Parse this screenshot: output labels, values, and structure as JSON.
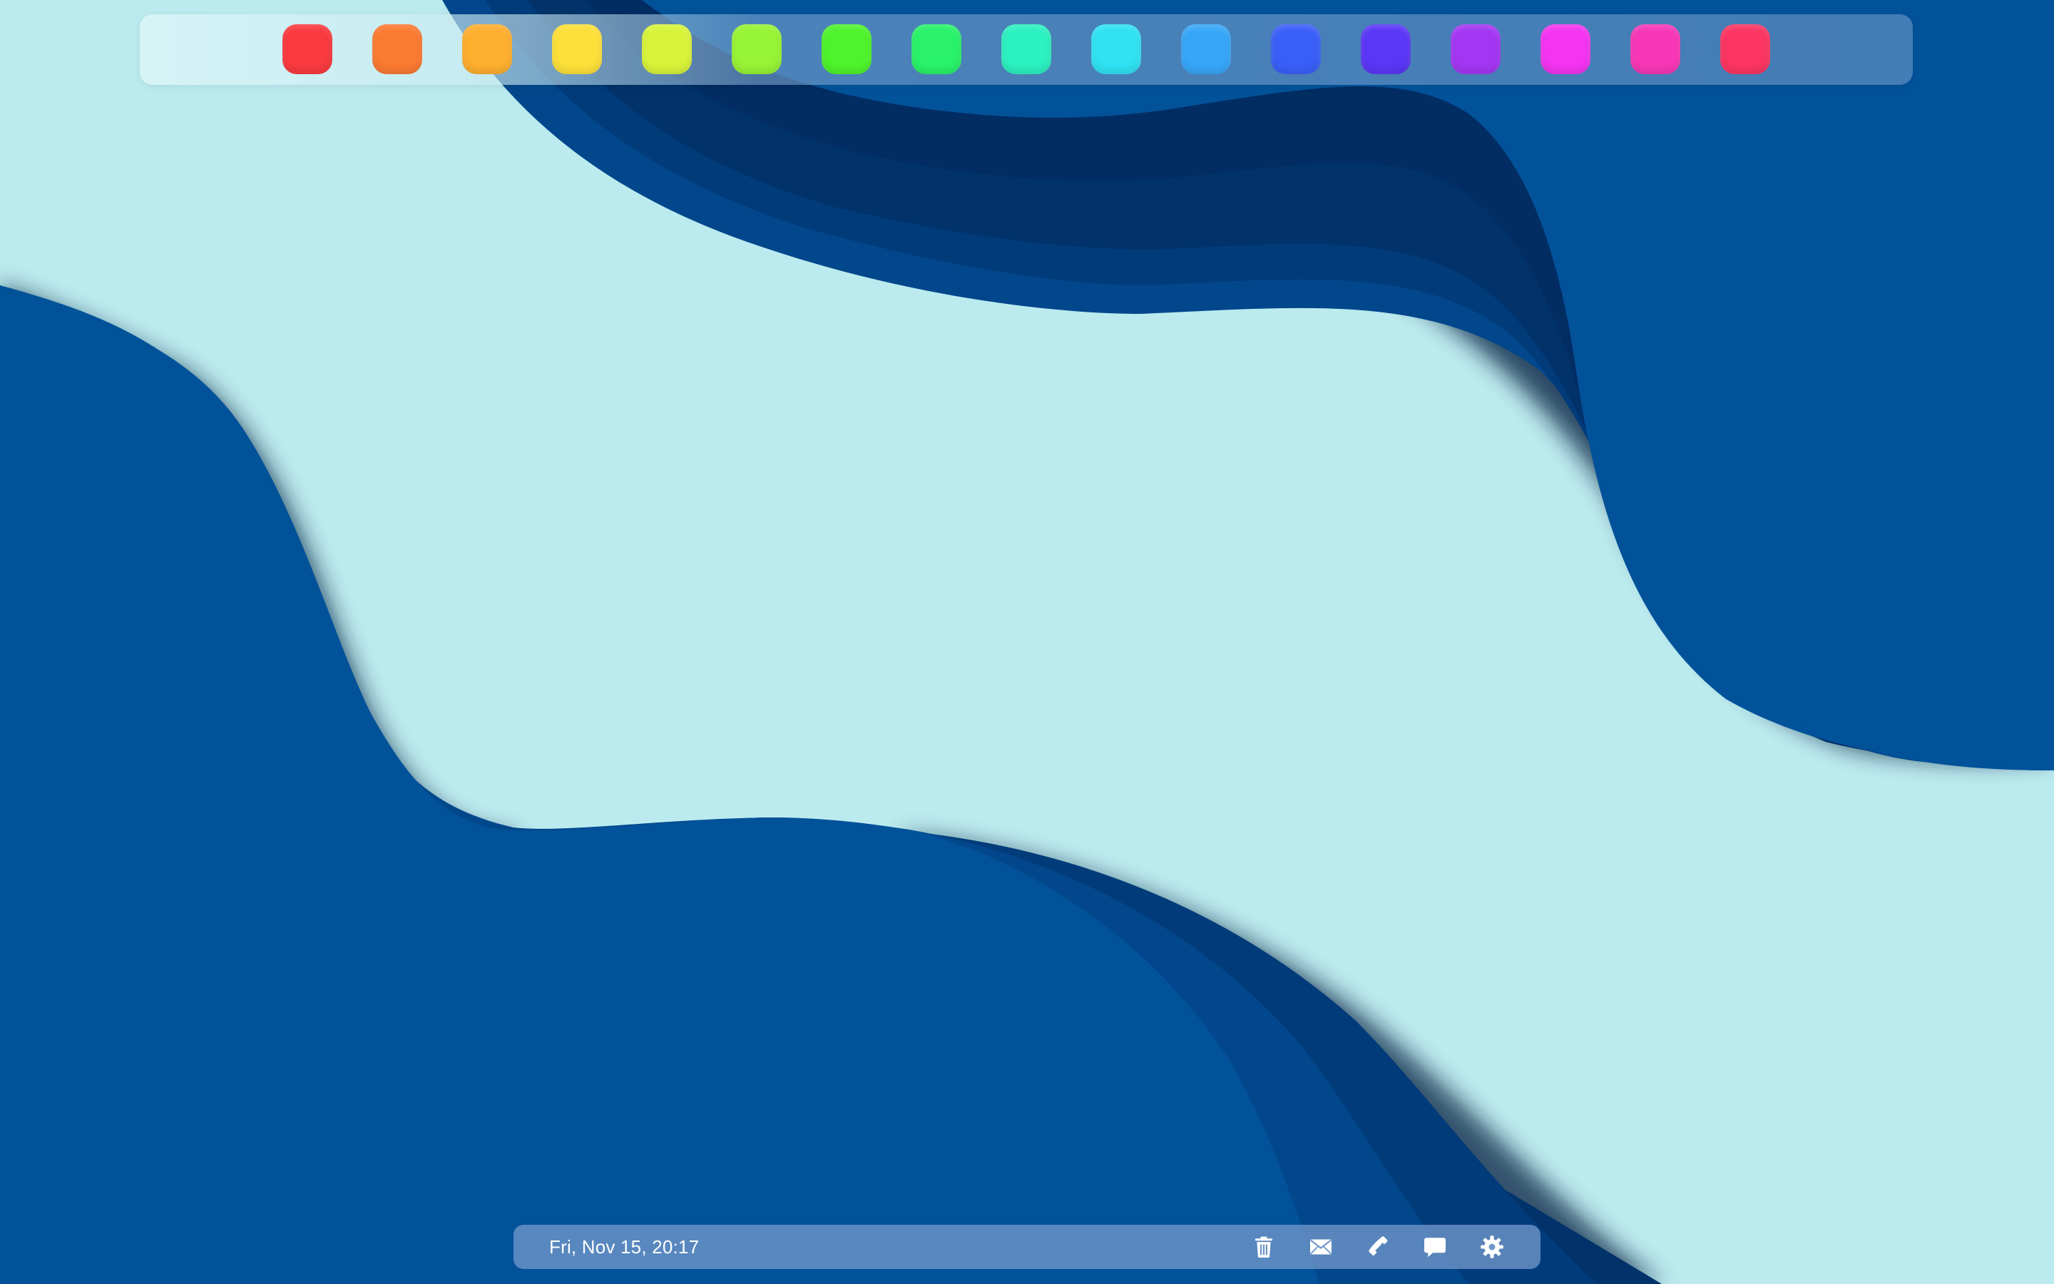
{
  "desktop": {
    "background_color": "#bbebef",
    "wave_color": "#02529a",
    "wave_shadow_color": "#001a3c"
  },
  "top_dock": {
    "apps": [
      {
        "name": "app-red",
        "color": "#f93a3f"
      },
      {
        "name": "app-orange",
        "color": "#fb7a32"
      },
      {
        "name": "app-amber",
        "color": "#fdaf2f"
      },
      {
        "name": "app-yellow",
        "color": "#fde03a"
      },
      {
        "name": "app-lime",
        "color": "#d8f33a"
      },
      {
        "name": "app-yellow-green",
        "color": "#97f335"
      },
      {
        "name": "app-green",
        "color": "#4ef32c"
      },
      {
        "name": "app-spring-green",
        "color": "#29f26a"
      },
      {
        "name": "app-aquamarine",
        "color": "#2cf1c0"
      },
      {
        "name": "app-cyan",
        "color": "#30e2f2"
      },
      {
        "name": "app-sky-blue",
        "color": "#37a6f8"
      },
      {
        "name": "app-blue",
        "color": "#3a5ff8"
      },
      {
        "name": "app-indigo",
        "color": "#5a36f6"
      },
      {
        "name": "app-purple",
        "color": "#a336f3"
      },
      {
        "name": "app-magenta",
        "color": "#f334f0"
      },
      {
        "name": "app-pink",
        "color": "#f737b7"
      },
      {
        "name": "app-crimson",
        "color": "#fb3562"
      }
    ]
  },
  "taskbar": {
    "datetime": "Fri, Nov 15, 20:17",
    "icons": [
      {
        "name": "trash-icon"
      },
      {
        "name": "mail-icon"
      },
      {
        "name": "phone-icon"
      },
      {
        "name": "chat-icon"
      },
      {
        "name": "settings-gear-icon"
      }
    ]
  }
}
